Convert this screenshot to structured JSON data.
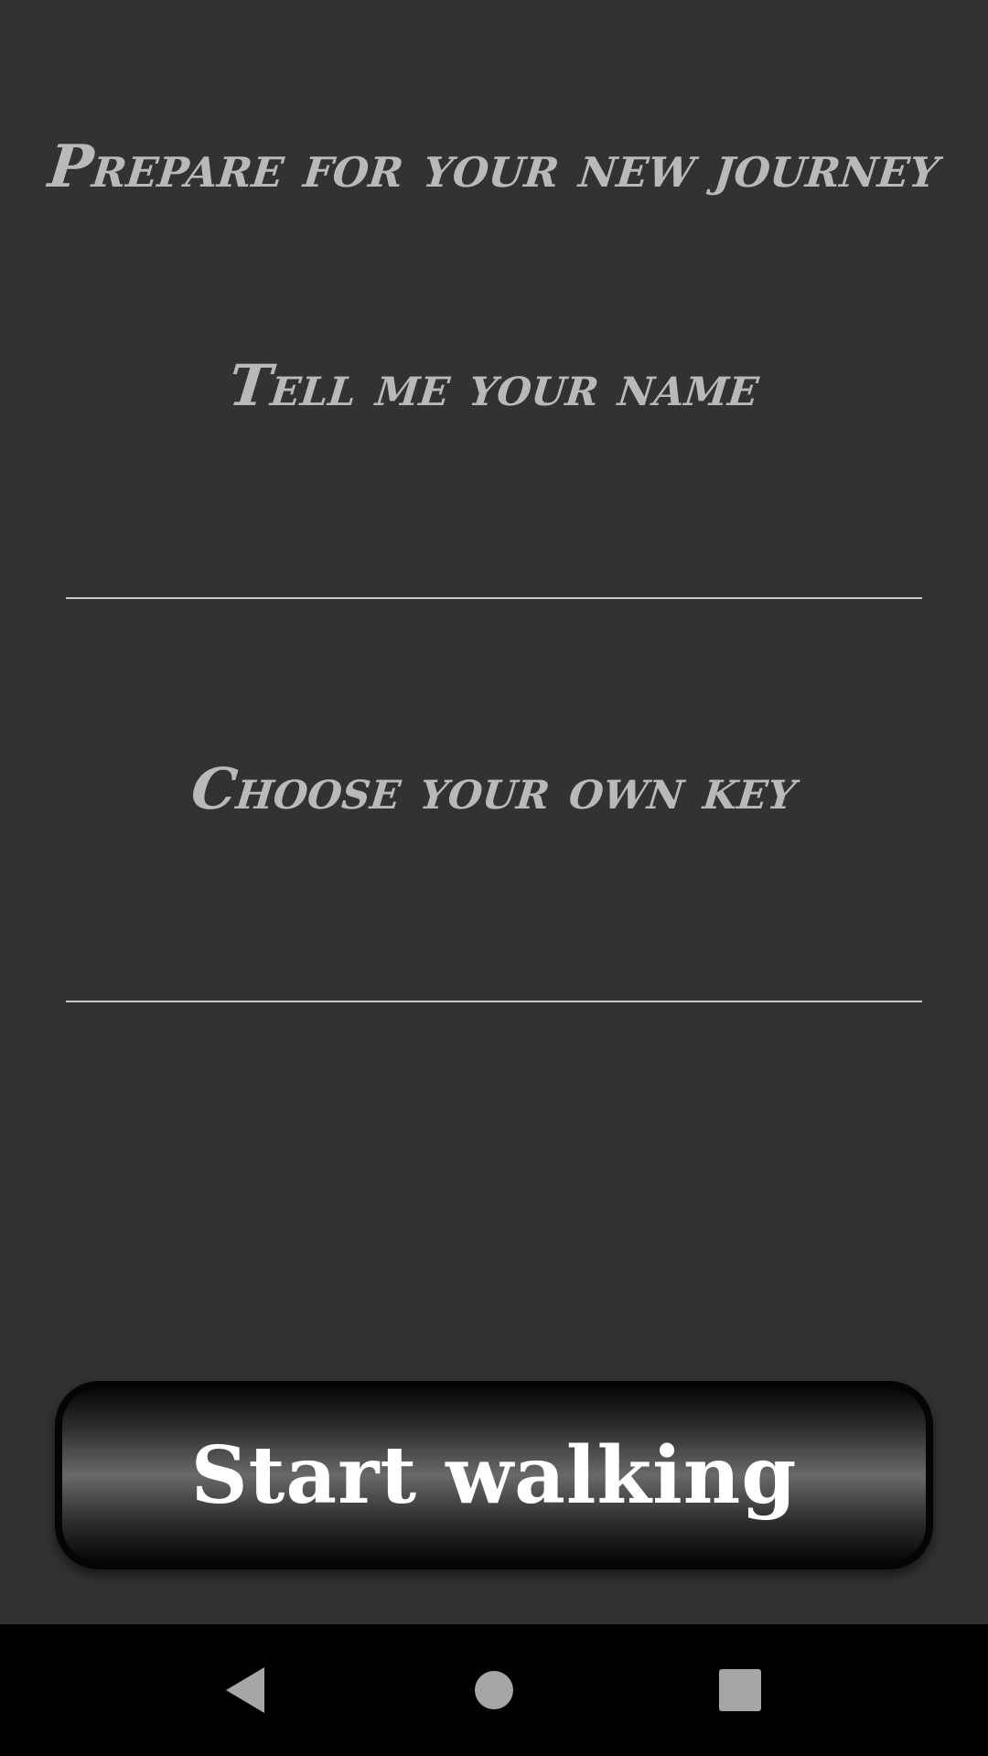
{
  "screen": {
    "title": "Prepare for your new journey",
    "name_prompt": "Tell me your name",
    "key_prompt": "Choose your own key"
  },
  "fields": {
    "name_value": "",
    "key_value": ""
  },
  "actions": {
    "start_label": "Start walking"
  },
  "navbar": {
    "back_icon": "back-triangle-icon",
    "home_icon": "home-circle-icon",
    "recents_icon": "recents-square-icon"
  },
  "colors": {
    "background": "#323232",
    "heading_text": "#b9b9b9",
    "underline": "#c8c8c8",
    "navbar": "#000000",
    "nav_icon": "#a6a6a6"
  }
}
